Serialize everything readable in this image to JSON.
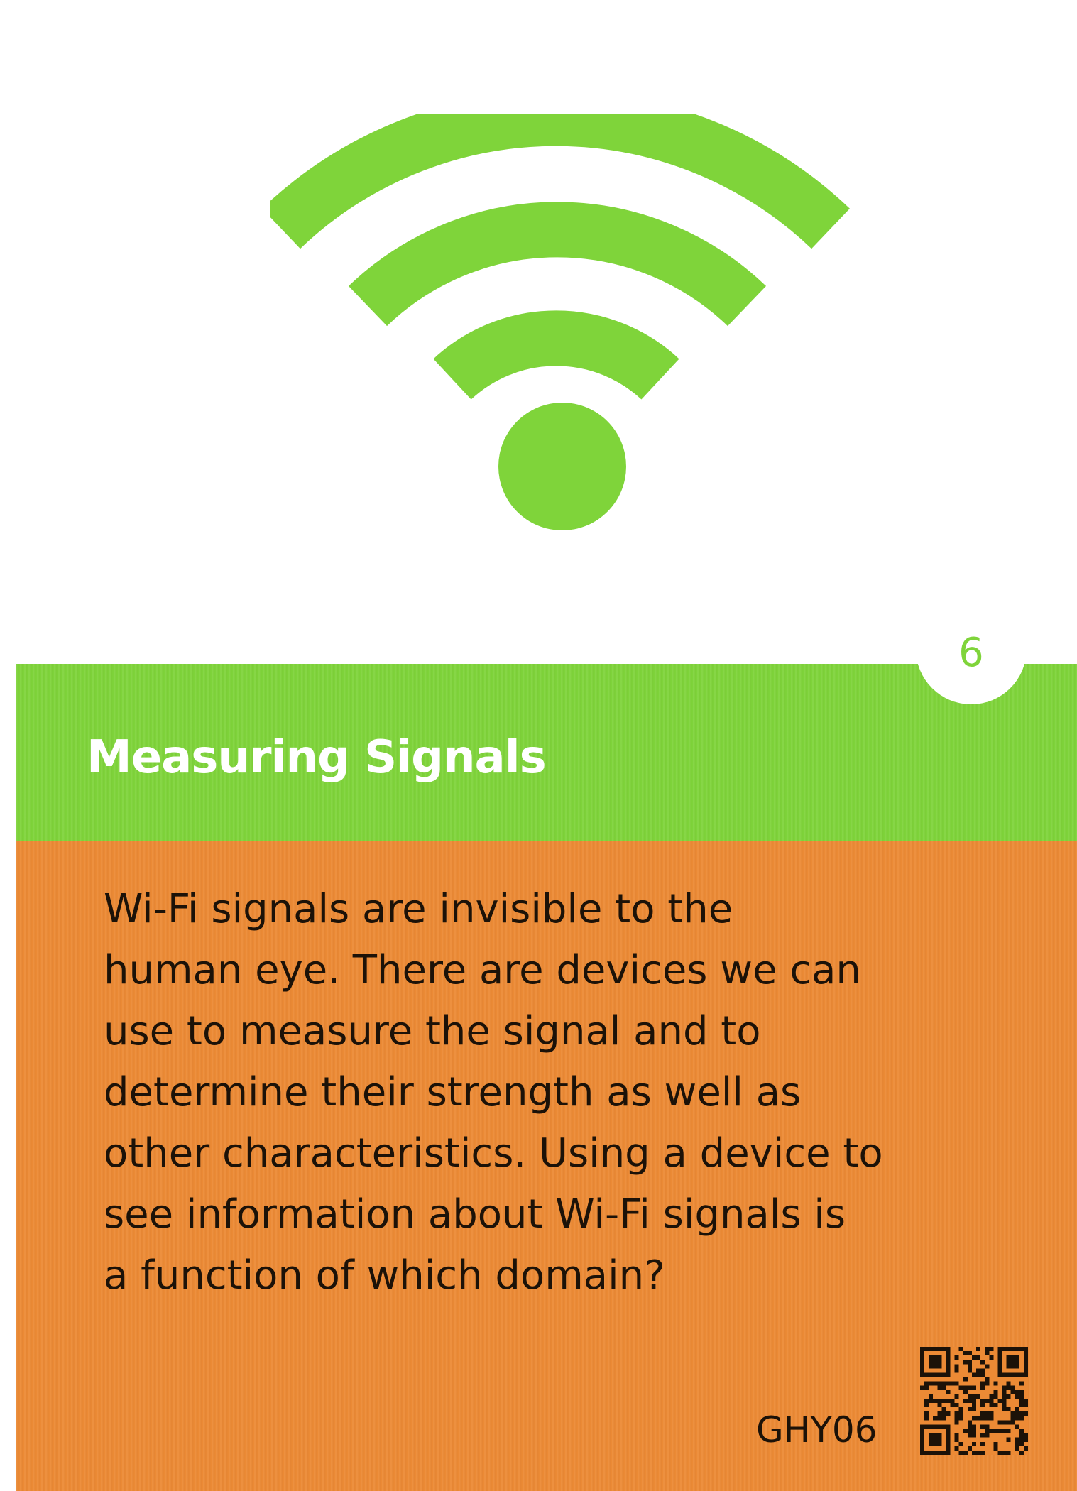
{
  "card": {
    "number": "6",
    "title": "Measuring Signals",
    "body_lines": [
      "Wi-Fi signals are invisible to the",
      "human eye. There are devices we can",
      "use to measure the signal and to",
      "determine their strength as well as",
      "other characteristics. Using a device to",
      "see information about Wi-Fi signals is",
      "a function of which domain?"
    ],
    "code": "GHY06",
    "icon": "wifi-icon",
    "qr_icon": "qr-code-icon"
  },
  "colors": {
    "green": "#7fd43a",
    "orange": "#ec8a35",
    "white": "#ffffff",
    "text": "#1c1208"
  }
}
